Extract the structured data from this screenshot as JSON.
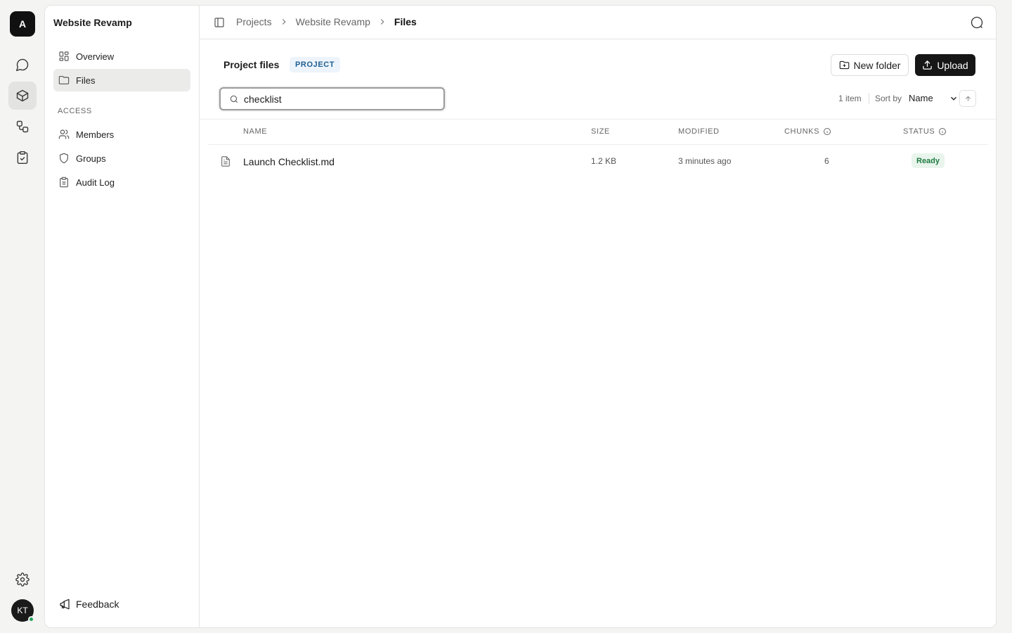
{
  "app": {
    "logo_letter": "A",
    "user_initials": "KT"
  },
  "sidebar": {
    "project_title": "Website Revamp",
    "items": [
      {
        "label": "Overview",
        "icon": "grid-icon"
      },
      {
        "label": "Files",
        "icon": "folder-icon",
        "active": true
      }
    ],
    "access_label": "ACCESS",
    "access_items": [
      {
        "label": "Members",
        "icon": "users-icon"
      },
      {
        "label": "Groups",
        "icon": "shield-icon"
      },
      {
        "label": "Audit Log",
        "icon": "clipboard-icon"
      }
    ],
    "feedback_label": "Feedback"
  },
  "breadcrumb": [
    "Projects",
    "Website Revamp",
    "Files"
  ],
  "files": {
    "title": "Project files",
    "badge": "PROJECT",
    "new_folder_label": "New folder",
    "upload_label": "Upload",
    "search_value": "checklist",
    "item_count": "1 item",
    "sort_label": "Sort by",
    "sort_value": "Name",
    "columns": {
      "name": "NAME",
      "size": "SIZE",
      "modified": "MODIFIED",
      "chunks": "CHUNKS",
      "status": "STATUS"
    },
    "rows": [
      {
        "name": "Launch Checklist.md",
        "size": "1.2 KB",
        "modified": "3 minutes ago",
        "chunks": "6",
        "status": "Ready"
      }
    ]
  },
  "colors": {
    "accent": "#161616",
    "badge_bg": "#edf4fb",
    "badge_fg": "#1f5f93",
    "ready_bg": "#e9f5ec",
    "ready_fg": "#1f7a43"
  }
}
